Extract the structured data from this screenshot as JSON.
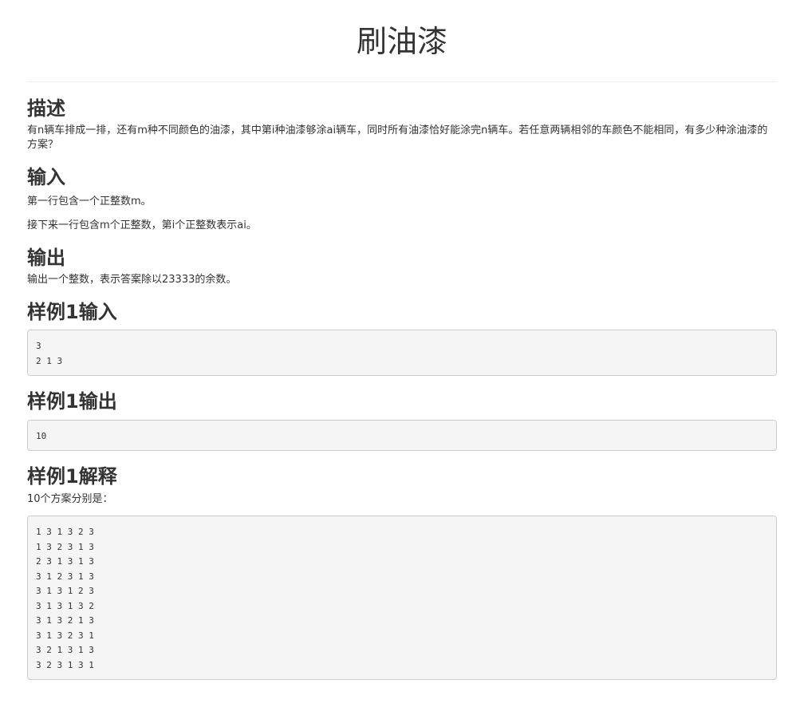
{
  "problem": {
    "title": "刷油漆",
    "description_heading": "描述",
    "description": "有n辆车排成一排，还有m种不同颜色的油漆，其中第i种油漆够涂ai辆车，同时所有油漆恰好能涂完n辆车。若任意两辆相邻的车颜色不能相同，有多少种涂油漆的方案？",
    "input_heading": "输入",
    "input_line1": "第一行包含一个正整数m。",
    "input_line2": "接下来一行包含m个正整数，第i个正整数表示ai。",
    "output_heading": "输出",
    "output_text": "输出一个整数，表示答案除以23333的余数。",
    "sample_input_heading": "样例1输入",
    "sample_input": "3\n2 1 3",
    "sample_output_heading": "样例1输出",
    "sample_output": "10",
    "explanation_heading": "样例1解释",
    "explanation_text": "10个方案分别是：",
    "explanation_block": "1 3 1 3 2 3\n1 3 2 3 1 3\n2 3 1 3 1 3\n3 1 2 3 1 3\n3 1 3 1 2 3\n3 1 3 1 3 2\n3 1 3 2 1 3\n3 1 3 2 3 1\n3 2 1 3 1 3\n3 2 3 1 3 1"
  }
}
